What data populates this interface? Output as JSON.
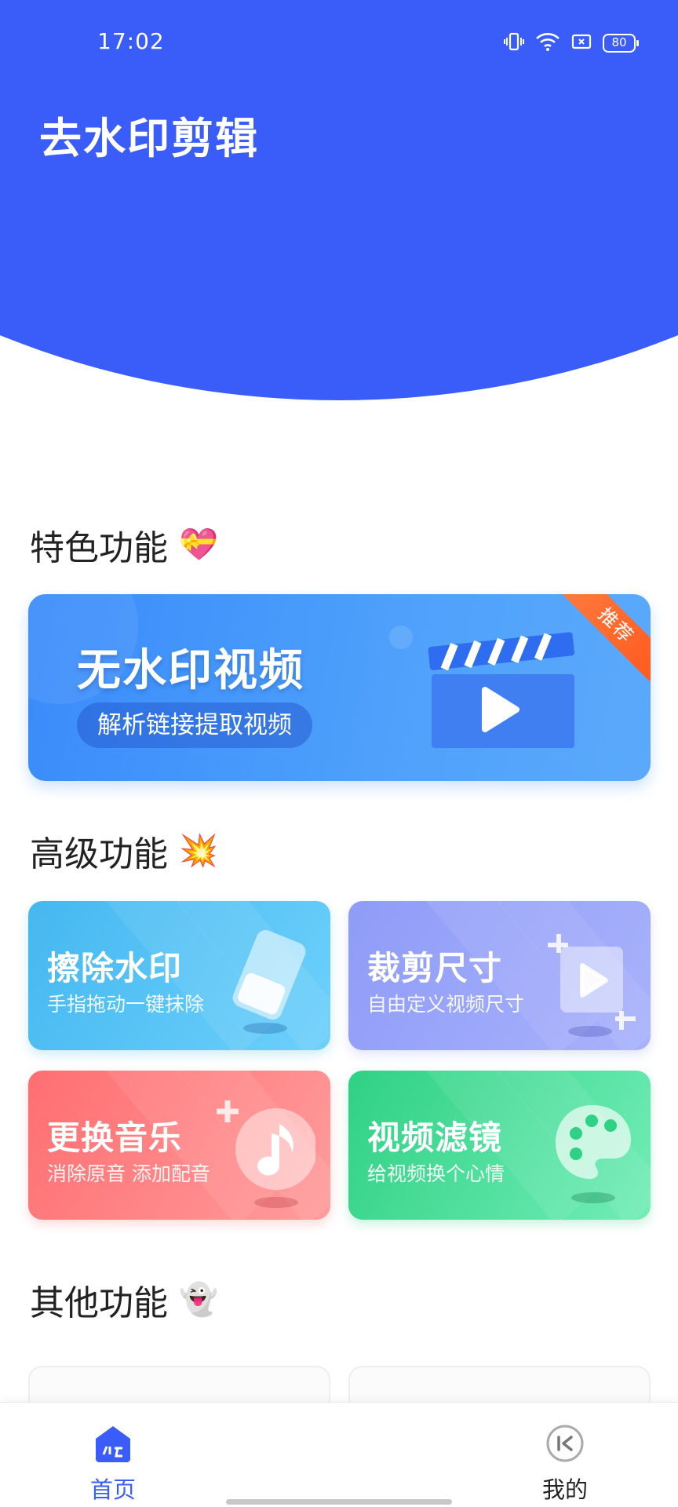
{
  "status_bar": {
    "time": "17:02",
    "battery": "80",
    "icons": [
      "vibrate-icon",
      "wifi-icon",
      "sim-icon",
      "battery-icon"
    ]
  },
  "app": {
    "title": "去水印剪辑",
    "accent_color": "#3a5cf8"
  },
  "sections": {
    "featured": {
      "title": "特色功能",
      "emoji": "💝"
    },
    "advanced": {
      "title": "高级功能",
      "emoji": "💥"
    },
    "other": {
      "title": "其他功能",
      "emoji": "👻"
    }
  },
  "banner": {
    "title": "无水印视频",
    "subtitle": "解析链接提取视频",
    "badge": "推荐",
    "icon": "clapperboard-play-icon"
  },
  "cards": [
    {
      "title": "擦除水印",
      "subtitle": "手指拖动一键抹除",
      "icon": "eraser-icon",
      "color": "#45b8f0"
    },
    {
      "title": "裁剪尺寸",
      "subtitle": "自由定义视频尺寸",
      "icon": "crop-video-icon",
      "color": "#8f9cf8"
    },
    {
      "title": "更换音乐",
      "subtitle": "消除原音 添加配音",
      "icon": "music-note-icon",
      "color": "#ff6e71"
    },
    {
      "title": "视频滤镜",
      "subtitle": "给视频换个心情",
      "icon": "palette-icon",
      "color": "#2fd184"
    }
  ],
  "bottom_nav": {
    "home": {
      "label": "首页",
      "icon": "home-icon",
      "active": true
    },
    "mine": {
      "label": "我的",
      "icon": "profile-back-icon",
      "active": false
    }
  }
}
